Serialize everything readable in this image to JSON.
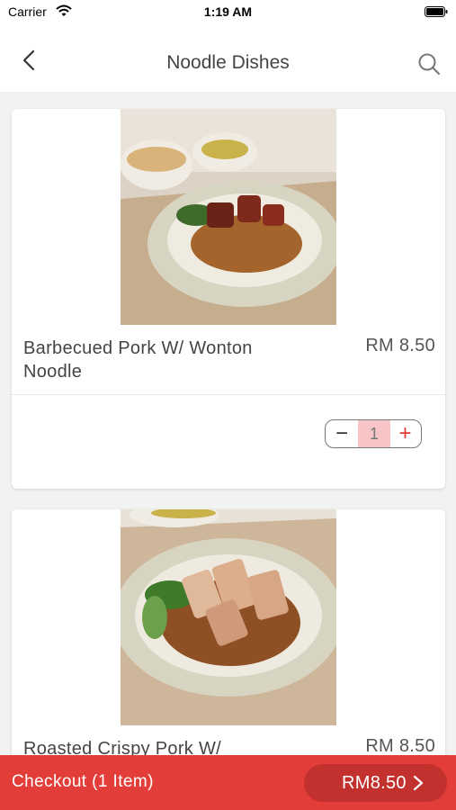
{
  "status_bar": {
    "carrier": "Carrier",
    "time": "1:19 AM"
  },
  "header": {
    "title": "Noodle Dishes",
    "back_icon": "chevron-left-icon",
    "search_icon": "search-icon"
  },
  "dishes": [
    {
      "name": "Barbecued Pork W/ Wonton Noodle",
      "price": "RM 8.50",
      "quantity": "1",
      "image": "wonton-noodle-char-siu-photo"
    },
    {
      "name": "Roasted Crispy Pork W/",
      "price": "RM 8.50",
      "image": "wonton-noodle-roast-pork-photo"
    }
  ],
  "checkout": {
    "label": "Checkout (1 Item)",
    "total": "RM8.50"
  },
  "colors": {
    "accent": "#e23d38",
    "accent_dark": "#c2312d",
    "qty_highlight": "#f7c5c5"
  }
}
